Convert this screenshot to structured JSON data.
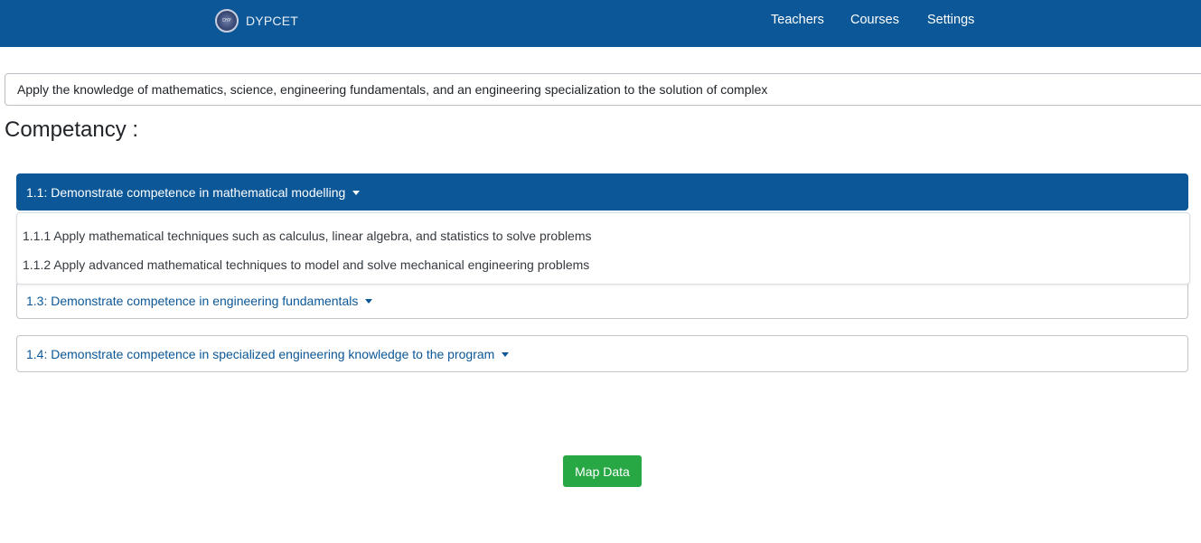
{
  "navbar": {
    "brand": "DYPCET",
    "links": [
      "Teachers",
      "Courses",
      "Settings"
    ],
    "bg_color": "#0b5797"
  },
  "outcome": {
    "value": "Apply the knowledge of mathematics, science, engineering fundamentals, and an engineering specialization to the solution of complex"
  },
  "competency": {
    "title": "Competancy :",
    "items": [
      {
        "label": "1.1: Demonstrate competence in mathematical modelling",
        "expanded": true,
        "options": [
          "1.1.1 Apply mathematical techniques such as calculus, linear algebra, and statistics to solve problems",
          "1.1.2 Apply advanced mathematical techniques to model and solve mechanical engineering problems"
        ]
      },
      {
        "label": "1.3: Demonstrate competence in engineering fundamentals",
        "expanded": false
      },
      {
        "label": "1.4: Demonstrate competence in specialized engineering knowledge to the program",
        "expanded": false
      }
    ]
  },
  "actions": {
    "map_label": "Map Data",
    "map_color": "#28a745"
  },
  "icons": {
    "logo": "college-seal-icon",
    "caret": "caret-down-icon"
  }
}
